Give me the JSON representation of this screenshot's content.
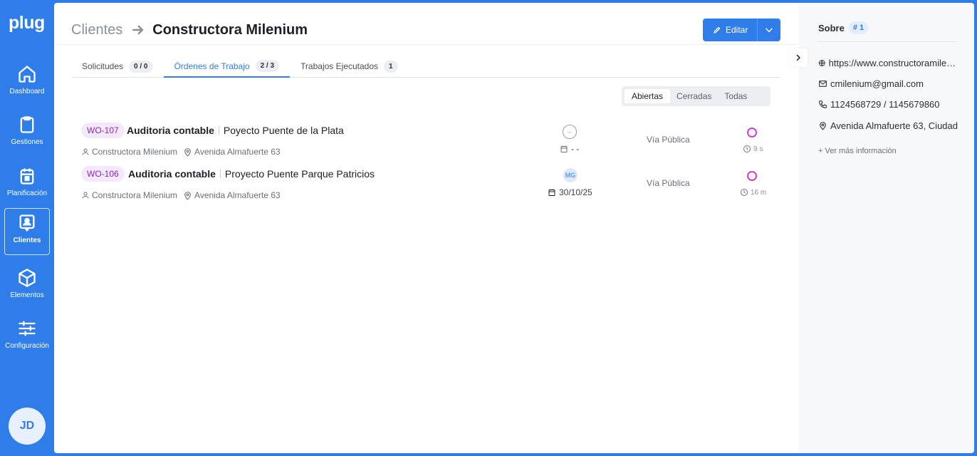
{
  "app": {
    "logo": "plug"
  },
  "nav": [
    {
      "label": "Dashboard",
      "icon": "home-icon"
    },
    {
      "label": "Gestiones",
      "icon": "clipboard-icon"
    },
    {
      "label": "Planificación",
      "icon": "calendar-icon"
    },
    {
      "label": "Clientes",
      "icon": "contact-icon",
      "active": true
    },
    {
      "label": "Elementos",
      "icon": "cube-icon"
    },
    {
      "label": "Configuración",
      "icon": "sliders-icon"
    }
  ],
  "user": {
    "initials": "JD"
  },
  "breadcrumb": {
    "parent": "Clientes",
    "title": "Constructora Milenium"
  },
  "actions": {
    "edit_label": "Editar"
  },
  "tabs": [
    {
      "label": "Solicitudes",
      "badge": "0 / 0"
    },
    {
      "label": "Órdenes de Trabajo",
      "badge": "2 / 3",
      "active": true
    },
    {
      "label": "Trabajos Ejecutados",
      "badge": "1"
    }
  ],
  "filter": {
    "options": [
      "Abiertas",
      "Cerradas",
      "Todas"
    ],
    "selected": "Abiertas"
  },
  "orders": [
    {
      "id": "WO-107",
      "title": "Auditoria contable",
      "project": "Poyecto Puente de la Plata",
      "client": "Constructora Milenium",
      "address": "Avenida Almafuerte 63",
      "assignee": "–",
      "due": "- -",
      "type": "Vía Pública",
      "elapsed": "9 s"
    },
    {
      "id": "WO-106",
      "title": "Auditoria contable",
      "project": "Proyecto Puente Parque Patricios",
      "client": "Constructora Milenium",
      "address": "Avenida Almafuerte 63",
      "assignee": "MG",
      "due": "30/10/25",
      "type": "Vía Pública",
      "elapsed": "16 m"
    }
  ],
  "panel": {
    "title": "Sobre",
    "number": "# 1",
    "website": "https://www.constructoramilenium.com",
    "email": "cmilenium@gmail.com",
    "phones": "1124568729 / 1145679860",
    "address": "Avenida Almafuerte 63, Ciudad",
    "more": "+ Ver más información"
  },
  "colors": {
    "brand": "#2f7de9",
    "wo_badge_bg": "#f4e8fb",
    "wo_badge_text": "#8a2bb5",
    "status": "#d33ddb"
  }
}
